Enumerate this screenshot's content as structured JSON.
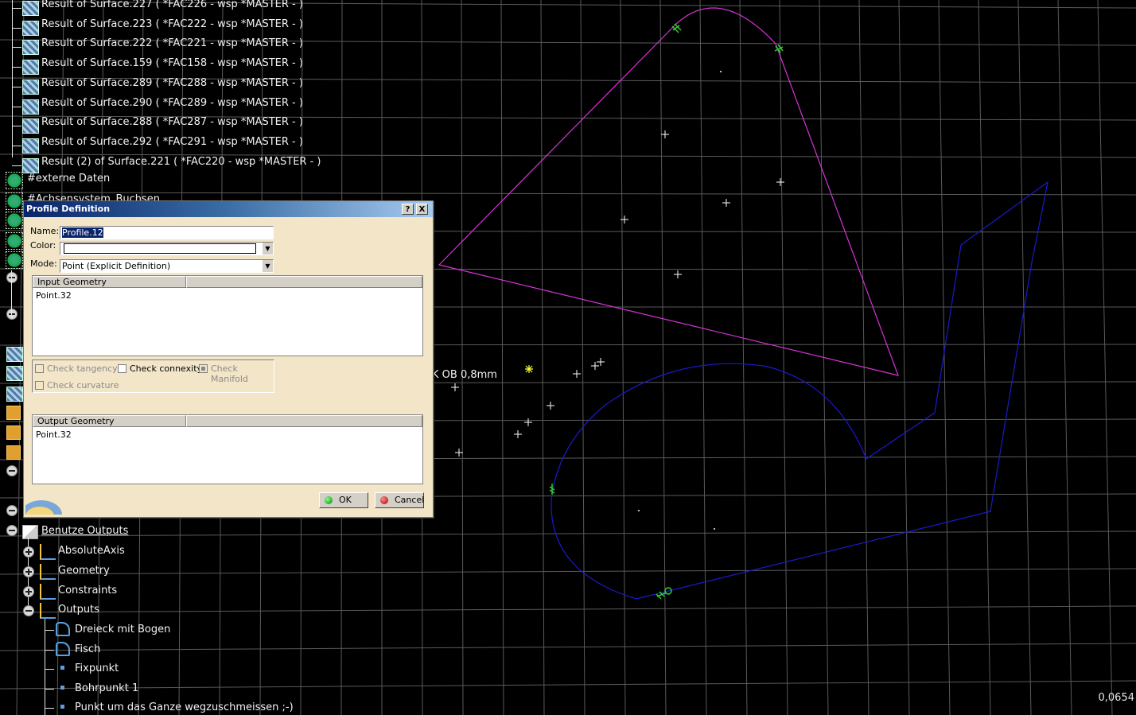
{
  "tree": {
    "results": [
      "Result of Surface.227 ( *FAC226 - wsp *MASTER -  )",
      "Result of Surface.223 ( *FAC222 - wsp *MASTER -  )",
      "Result of Surface.222 ( *FAC221 - wsp *MASTER -  )",
      "Result of Surface.159 ( *FAC158 - wsp *MASTER -  )",
      "Result of Surface.289 ( *FAC288 - wsp *MASTER -  )",
      "Result of Surface.290 ( *FAC289 - wsp *MASTER -  )",
      "Result of Surface.288 ( *FAC287 - wsp *MASTER -  )",
      "Result of Surface.292 ( *FAC291 - wsp *MASTER -  )",
      "Result (2) of Surface.221 ( *FAC220 - wsp *MASTER -  )"
    ],
    "externe_daten": "#externe Daten",
    "achsensystem": "#Achsensystem_Buchsen",
    "benutze_outputs": "Benutze Outputs",
    "children": [
      "AbsoluteAxis",
      "Geometry",
      "Constraints",
      "Outputs"
    ],
    "outputs": [
      "Dreieck mit Bogen",
      "Fisch",
      "Fixpunkt",
      "Bohrpunkt 1",
      "Punkt um das Ganze wegzuschmeissen ;-)"
    ]
  },
  "viewport": {
    "dimension_label": "K OB 0,8mm",
    "status_value": "0,0654",
    "colors": {
      "grid": "#5a5a5a",
      "profile_magenta": "#d633d6",
      "profile_blue": "#1a1acc",
      "constraint_green": "#33cc33",
      "cross_white": "#ffffff",
      "highlight_yellow": "#ffff33"
    }
  },
  "dialog": {
    "title": "Profile Definition",
    "help_button": "?",
    "close_button": "X",
    "name_label": "Name:",
    "name_value": "Profile.12",
    "color_label": "Color:",
    "color_value": "",
    "mode_label": "Mode:",
    "mode_value": "Point (Explicit Definition)",
    "input_header": "Input Geometry",
    "input_items": [
      "Point.32"
    ],
    "check_tangency": "Check tangency",
    "check_connexity": "Check connexity",
    "check_manifold": "Check Manifold",
    "check_curvature": "Check curvature",
    "output_header": "Output Geometry",
    "output_items": [
      "Point.32"
    ],
    "ok_label": "OK",
    "cancel_label": "Cancel"
  }
}
